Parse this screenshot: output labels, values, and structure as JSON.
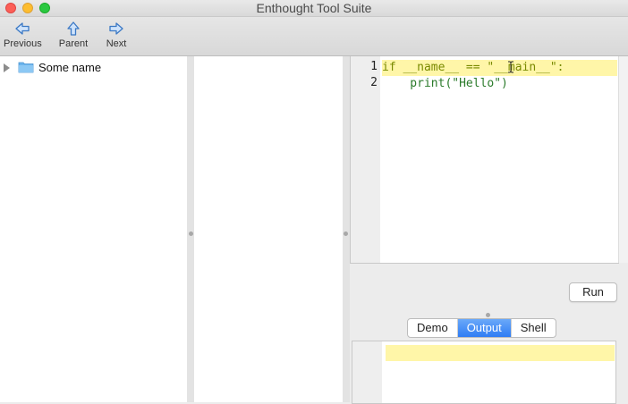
{
  "window": {
    "title": "Enthought Tool Suite"
  },
  "toolbar": {
    "previous_label": "Previous",
    "parent_label": "Parent",
    "next_label": "Next"
  },
  "tree": {
    "items": [
      {
        "label": "Some name",
        "icon": "folder-icon",
        "expanded": false
      }
    ]
  },
  "editor": {
    "lines": [
      {
        "number": "1",
        "text": "if __name__ == \"__main__\":"
      },
      {
        "number": "2",
        "text": "    print(\"Hello\")"
      }
    ],
    "highlight_color": "#fff6a8"
  },
  "run": {
    "label": "Run"
  },
  "tabs": [
    {
      "label": "Demo",
      "active": false
    },
    {
      "label": "Output",
      "active": true
    },
    {
      "label": "Shell",
      "active": false
    }
  ],
  "colors": {
    "accent": "#2f7cf4",
    "traffic_close": "#fc5f57",
    "traffic_min": "#fdbd2f",
    "traffic_max": "#2ac840"
  }
}
